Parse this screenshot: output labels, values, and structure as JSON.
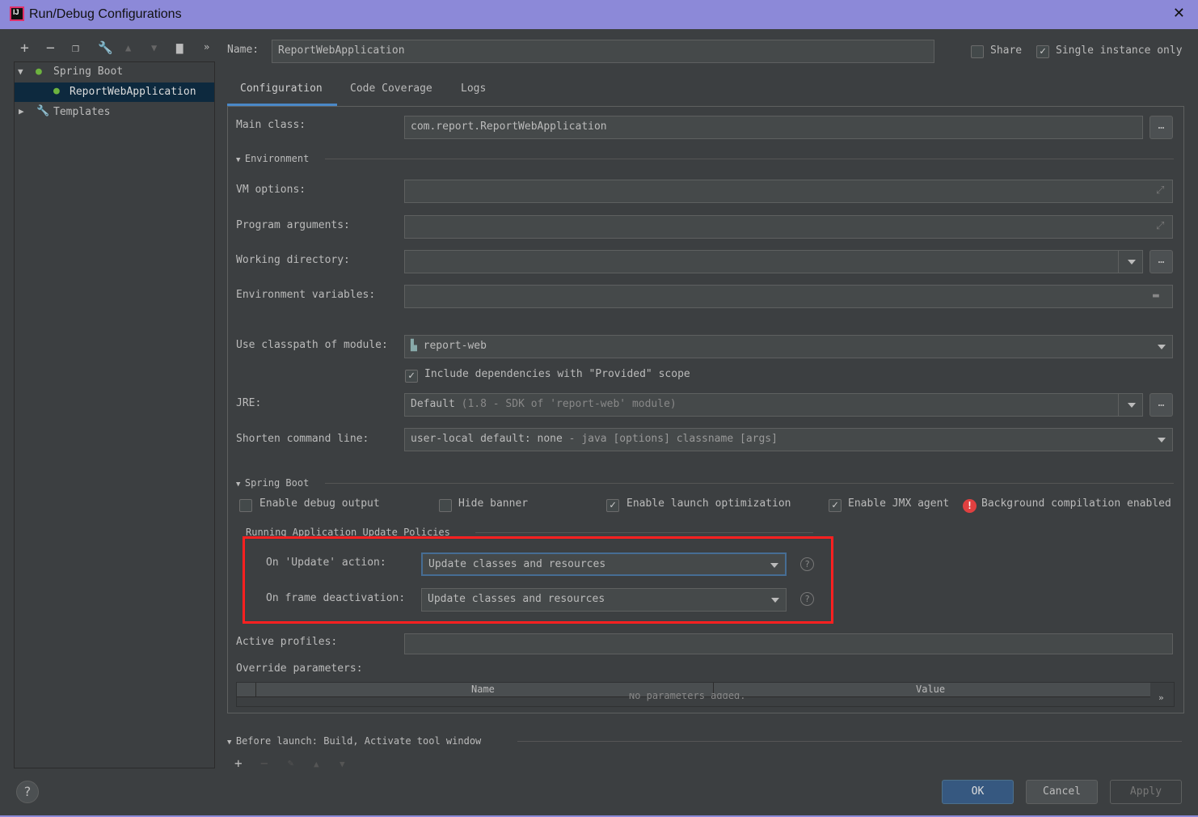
{
  "window": {
    "title": "Run/Debug Configurations",
    "logo": "IJ"
  },
  "toolbar": {
    "more": "»"
  },
  "tree": {
    "items": [
      {
        "label": "Spring Boot"
      },
      {
        "label": "ReportWebApplication"
      },
      {
        "label": "Templates"
      }
    ]
  },
  "name": {
    "label": "Name:",
    "value": "ReportWebApplication"
  },
  "share": {
    "label": "Share",
    "checked": false
  },
  "single_instance": {
    "label": "Single instance only",
    "checked": true
  },
  "tabs": [
    {
      "label": "Configuration",
      "active": true
    },
    {
      "label": "Code Coverage"
    },
    {
      "label": "Logs"
    }
  ],
  "config": {
    "main_class": {
      "label": "Main class:",
      "value": "com.report.ReportWebApplication"
    },
    "environment_section": "Environment",
    "vm_options": {
      "label": "VM options:",
      "value": ""
    },
    "program_args": {
      "label": "Program arguments:",
      "value": ""
    },
    "working_dir": {
      "label": "Working directory:",
      "value": ""
    },
    "env_vars": {
      "label": "Environment variables:",
      "value": ""
    },
    "classpath": {
      "label": "Use classpath of module:",
      "value": "report-web"
    },
    "include_deps": {
      "label": "Include dependencies with \"Provided\" scope",
      "checked": true
    },
    "jre": {
      "label": "JRE:",
      "value": "Default",
      "hint": "(1.8 - SDK of 'report-web' module)"
    },
    "shorten": {
      "label": "Shorten command line:",
      "value": "user-local default: none",
      "hint": "- java [options] classname [args]"
    },
    "spring_section": "Spring Boot",
    "debug_output": {
      "label": "Enable debug output",
      "checked": false
    },
    "hide_banner": {
      "label": "Hide banner",
      "checked": false
    },
    "launch_opt": {
      "label": "Enable launch optimization",
      "checked": true
    },
    "jmx": {
      "label": "Enable JMX agent",
      "checked": true
    },
    "bg_compilation": "Background compilation enabled",
    "policies_title": "Running Application Update Policies",
    "on_update": {
      "label": "On 'Update' action:",
      "value": "Update classes and resources"
    },
    "on_frame": {
      "label": "On frame deactivation:",
      "value": "Update classes and resources"
    },
    "active_profiles": {
      "label": "Active profiles:",
      "value": ""
    },
    "override_label": "Override parameters:",
    "table": {
      "columns": [
        "Name",
        "Value"
      ],
      "empty": "No parameters added."
    }
  },
  "before_launch": "Before launch: Build, Activate tool window",
  "buttons": {
    "ok": "OK",
    "cancel": "Cancel",
    "apply": "Apply",
    "help": "?"
  },
  "colors": {
    "title_bar": "#8c89d8",
    "highlight": "#ff2020",
    "ok": "#365880",
    "selection": "#0d293e"
  }
}
